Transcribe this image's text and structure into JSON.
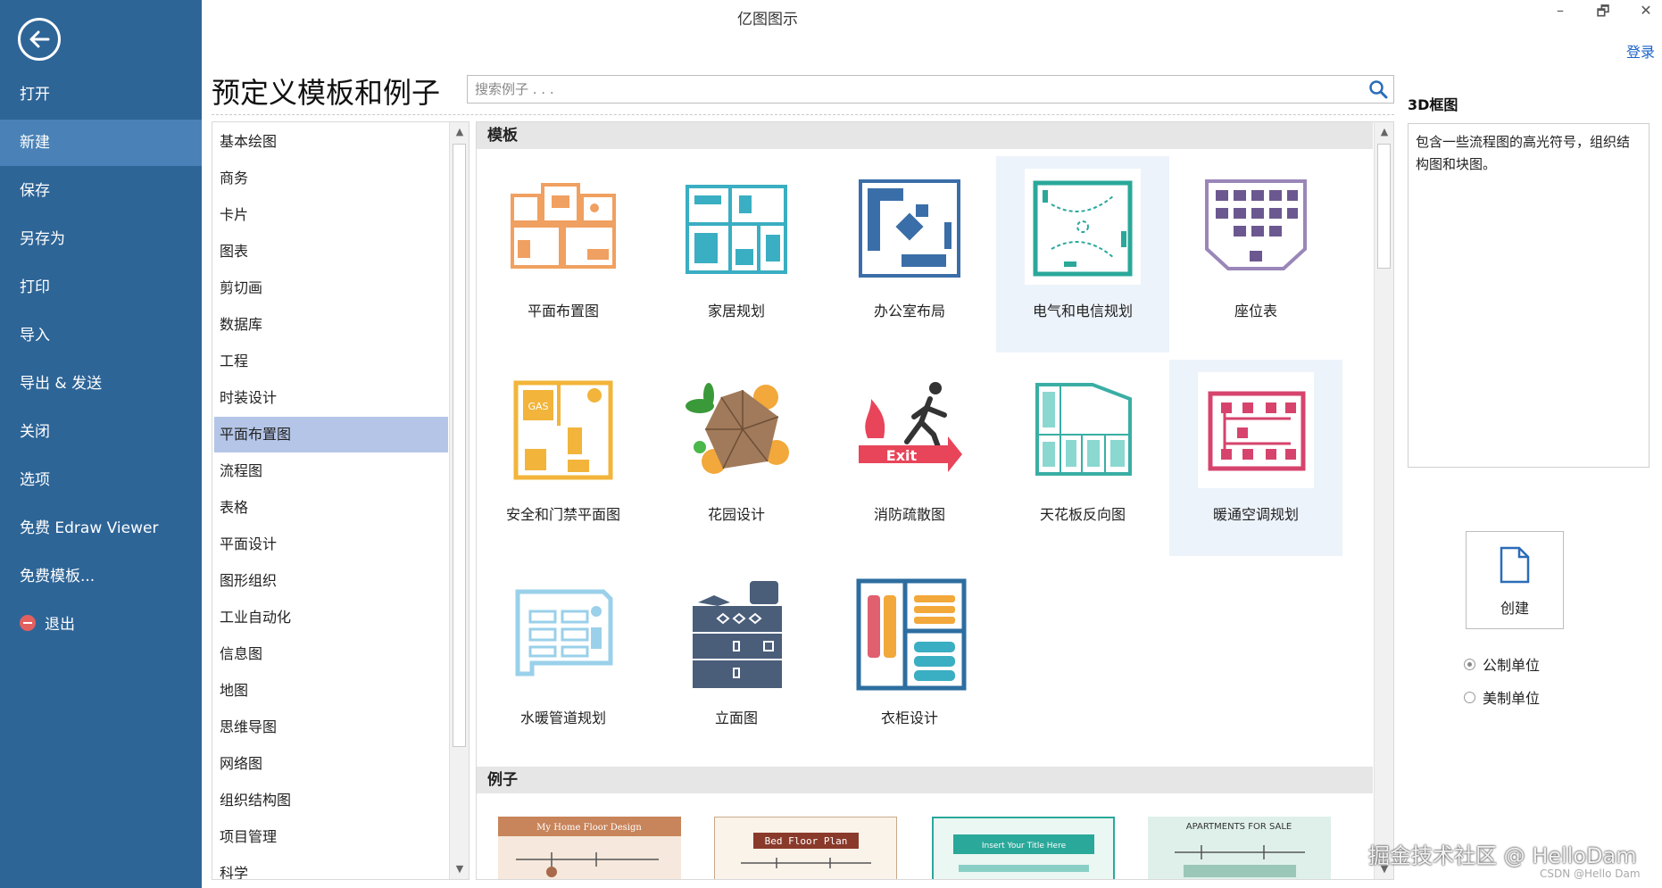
{
  "window": {
    "title": "亿图图示",
    "minimize": "–",
    "restore": "🗗",
    "close": "✕",
    "login": "登录"
  },
  "sidebar": {
    "items": [
      "打开",
      "新建",
      "保存",
      "另存为",
      "打印",
      "导入",
      "导出 & 发送",
      "关闭",
      "选项",
      "免费 Edraw Viewer",
      "免费模板...",
      "退出"
    ],
    "active_index": 1
  },
  "page": {
    "title": "预定义模板和例子",
    "search_placeholder": "搜索例子 . . ."
  },
  "categories": {
    "items": [
      "基本绘图",
      "商务",
      "卡片",
      "图表",
      "剪切画",
      "数据库",
      "工程",
      "时装设计",
      "平面布置图",
      "流程图",
      "表格",
      "平面设计",
      "图形组织",
      "工业自动化",
      "信息图",
      "地图",
      "思维导图",
      "网络图",
      "组织结构图",
      "项目管理",
      "科学"
    ],
    "active_index": 8
  },
  "content": {
    "templates_header": "模板",
    "examples_header": "例子",
    "templates": [
      "平面布置图",
      "家居规划",
      "办公室布局",
      "电气和电信规划",
      "座位表",
      "安全和门禁平面图",
      "花园设计",
      "消防疏散图",
      "天花板反向图",
      "暖通空调规划",
      "水暖管道规划",
      "立面图",
      "衣柜设计"
    ],
    "exit_sign_text": "Exit",
    "gas_text": "GAS",
    "examples": [
      "My Home Floor Design",
      "Bed Floor Plan",
      "Insert Your Title Here",
      "APARTMENTS FOR SALE"
    ]
  },
  "right_panel": {
    "title": "3D框图",
    "description": "包含一些流程图的高光符号，组织结构图和块图。",
    "create_label": "创建",
    "units": [
      "公制单位",
      "美制单位"
    ],
    "selected_unit_index": 0
  },
  "watermark": {
    "main": "掘金技术社区 @ HelloDam",
    "small": "CSDN @Hello Dam"
  }
}
